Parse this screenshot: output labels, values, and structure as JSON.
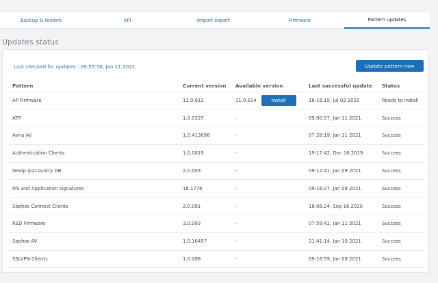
{
  "tabs": [
    {
      "label": "Backup & restore",
      "active": false
    },
    {
      "label": "API",
      "active": false
    },
    {
      "label": "Import export",
      "active": false
    },
    {
      "label": "Firmware",
      "active": false
    },
    {
      "label": "Pattern updates",
      "active": true
    }
  ],
  "section_title": "Updates status",
  "last_checked": "Last checked for updates  :  09:55:56, Jan 11 2021",
  "update_button": "Update pattern now",
  "table": {
    "headers": [
      "Pattern",
      "Current version",
      "Available version",
      "Last successful update",
      "Status"
    ],
    "rows": [
      {
        "pattern": "AP Firmware",
        "current": "11.0.012",
        "available": "11.0.014",
        "last": "18:16:15, Jul 02 2020",
        "status": "Ready to install",
        "install": "Install"
      },
      {
        "pattern": "ATP",
        "current": "1.0.0337",
        "available": "-",
        "last": "09:00:57, Jan 11 2021",
        "status": "Success"
      },
      {
        "pattern": "Avira AV",
        "current": "1.0.413096",
        "available": "-",
        "last": "07:28:19, Jan 11 2021",
        "status": "Success"
      },
      {
        "pattern": "Authentication Clients",
        "current": "1.0.0019",
        "available": "-",
        "last": "19:17:42, Dec 16 2019",
        "status": "Success"
      },
      {
        "pattern": "Geoip ip2country DB",
        "current": "2.0.003",
        "available": "-",
        "last": "09:12:41, Jan 09 2021",
        "status": "Success"
      },
      {
        "pattern": "IPS and Application signatures",
        "current": "18.1776",
        "available": "-",
        "last": "09:16:27, Jan 09 2021",
        "status": "Success"
      },
      {
        "pattern": "Sophos Connect Clients",
        "current": "2.0.001",
        "available": "-",
        "last": "18:08:24, Sep 16 2020",
        "status": "Success"
      },
      {
        "pattern": "RED Firmware",
        "current": "3.0.003",
        "available": "-",
        "last": "07:59:42, Jan 11 2021",
        "status": "Success"
      },
      {
        "pattern": "Sophos AV",
        "current": "1.0.16457",
        "available": "-",
        "last": "21:41:14, Jan 10 2021",
        "status": "Success"
      },
      {
        "pattern": "SSLVPN Clients",
        "current": "1.0.008",
        "available": "-",
        "last": "09:16:59, Jan 09 2021",
        "status": "Success"
      }
    ]
  },
  "colors": {
    "accent": "#1f6fb8",
    "background": "#f3f4f6",
    "panel": "#ffffff"
  }
}
